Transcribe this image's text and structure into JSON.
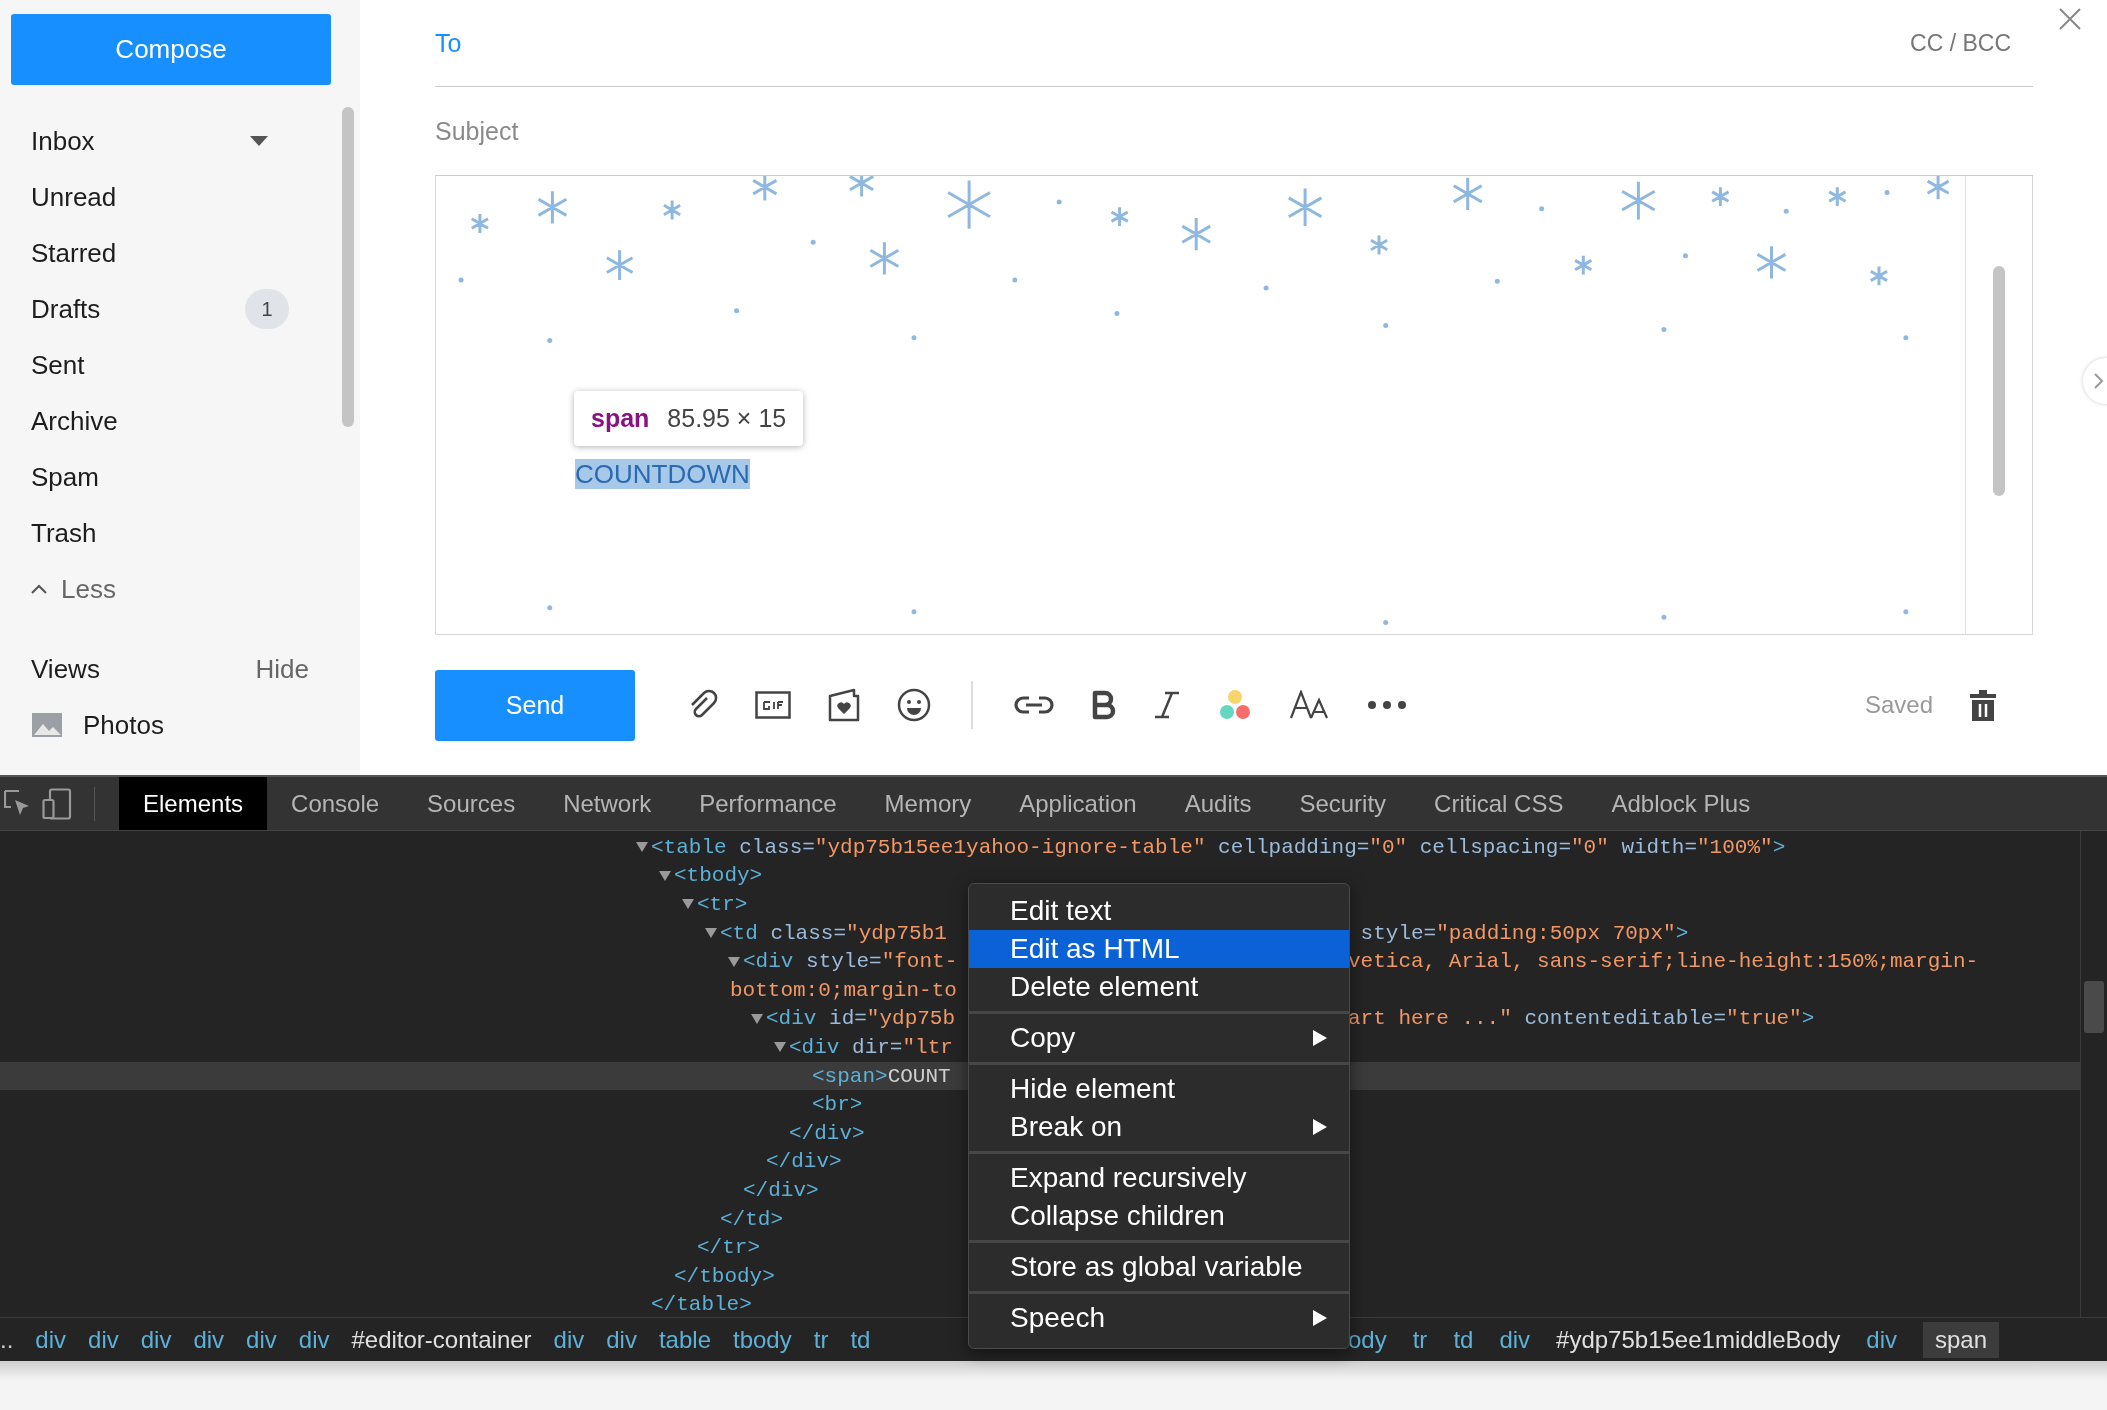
{
  "sidebar": {
    "compose": "Compose",
    "folders": [
      {
        "label": "Inbox",
        "kind": "dropdown"
      },
      {
        "label": "Unread",
        "kind": "plain"
      },
      {
        "label": "Starred",
        "kind": "plain"
      },
      {
        "label": "Drafts",
        "kind": "count",
        "count": "1"
      },
      {
        "label": "Sent",
        "kind": "plain"
      },
      {
        "label": "Archive",
        "kind": "plain"
      },
      {
        "label": "Spam",
        "kind": "plain"
      },
      {
        "label": "Trash",
        "kind": "plain"
      }
    ],
    "less": "Less",
    "views": "Views",
    "hide": "Hide",
    "photos": "Photos"
  },
  "compose": {
    "to_label": "To",
    "cc_bcc": "CC / BCC",
    "subject_placeholder": "Subject",
    "body": {
      "tooltip": {
        "tag": "span",
        "size": "85.95 × 15"
      },
      "selected_text": "COUNTDOWN"
    },
    "send": "Send",
    "status": "Saved"
  },
  "devtools": {
    "tabs": [
      {
        "label": "Elements",
        "selected": true
      },
      {
        "label": "Console",
        "selected": false
      },
      {
        "label": "Sources",
        "selected": false
      },
      {
        "label": "Network",
        "selected": false
      },
      {
        "label": "Performance",
        "selected": false
      },
      {
        "label": "Memory",
        "selected": false
      },
      {
        "label": "Application",
        "selected": false
      },
      {
        "label": "Audits",
        "selected": false
      },
      {
        "label": "Security",
        "selected": false
      },
      {
        "label": "Critical CSS",
        "selected": false
      },
      {
        "label": "Adblock Plus",
        "selected": false
      }
    ],
    "tree": [
      {
        "expanded": true,
        "selected": false,
        "open": [
          {
            "kind": "tag",
            "text": "<table"
          },
          {
            "kind": "attr",
            "text": " class="
          },
          {
            "kind": "value",
            "text": "\"ydp75b15ee1yahoo-ignore-table\""
          },
          {
            "kind": "attr",
            "text": " cellpadding="
          },
          {
            "kind": "value",
            "text": "\"0\""
          },
          {
            "kind": "attr",
            "text": " cellspacing="
          },
          {
            "kind": "value",
            "text": "\"0\""
          },
          {
            "kind": "attr",
            "text": " width="
          },
          {
            "kind": "value",
            "text": "\"100%\""
          },
          {
            "kind": "tag",
            "text": ">"
          }
        ],
        "close": "</table>",
        "children": [
          {
            "expanded": true,
            "selected": false,
            "open": [
              {
                "kind": "tag",
                "text": "<tbody>"
              }
            ],
            "close": "</tbody>",
            "children": [
              {
                "expanded": true,
                "selected": false,
                "open": [
                  {
                    "kind": "tag",
                    "text": "<tr>"
                  }
                ],
                "close": "</tr>",
                "children": [
                  {
                    "expanded": true,
                    "selected": false,
                    "open": [
                      {
                        "kind": "tag",
                        "text": "<td"
                      },
                      {
                        "kind": "attr",
                        "text": " class="
                      },
                      {
                        "kind": "value",
                        "text": "\"ydp75b1"
                      }
                    ],
                    "right": [
                      {
                        "kind": "attr",
                        "text": " style="
                      },
                      {
                        "kind": "value",
                        "text": "\"padding:50px 70px\""
                      },
                      {
                        "kind": "tag",
                        "text": ">"
                      }
                    ],
                    "close": "</td>",
                    "children": [
                      {
                        "expanded": true,
                        "selected": false,
                        "open": [
                          {
                            "kind": "tag",
                            "text": "<div"
                          },
                          {
                            "kind": "attr",
                            "text": " style="
                          },
                          {
                            "kind": "value",
                            "text": "\"font-"
                          }
                        ],
                        "right": [
                          {
                            "kind": "value",
                            "text": "vetica, Arial, sans-serif;line-height:150%;margin-"
                          }
                        ],
                        "wrap": [
                          {
                            "kind": "value",
                            "text": "bottom:0;margin-to"
                          }
                        ],
                        "close": "</div>",
                        "children": [
                          {
                            "expanded": true,
                            "selected": false,
                            "open": [
                              {
                                "kind": "tag",
                                "text": "<div"
                              },
                              {
                                "kind": "attr",
                                "text": " id="
                              },
                              {
                                "kind": "value",
                                "text": "\"ydp75b"
                              }
                            ],
                            "right": [
                              {
                                "kind": "value",
                                "text": "art here ...\""
                              },
                              {
                                "kind": "attr",
                                "text": " contenteditable="
                              },
                              {
                                "kind": "value",
                                "text": "\"true\""
                              },
                              {
                                "kind": "tag",
                                "text": ">"
                              }
                            ],
                            "close": "</div>",
                            "children": [
                              {
                                "expanded": true,
                                "selected": false,
                                "open": [
                                  {
                                    "kind": "tag",
                                    "text": "<div"
                                  },
                                  {
                                    "kind": "attr",
                                    "text": " dir="
                                  },
                                  {
                                    "kind": "value",
                                    "text": "\"ltr"
                                  }
                                ],
                                "close": "</div>",
                                "children": [
                                  {
                                    "selected": true,
                                    "open": [
                                      {
                                        "kind": "tag",
                                        "text": "<span>"
                                      },
                                      {
                                        "kind": "text",
                                        "text": "COUNT"
                                      }
                                    ]
                                  },
                                  {
                                    "selected": false,
                                    "open": [
                                      {
                                        "kind": "tag",
                                        "text": "<br>"
                                      }
                                    ]
                                  }
                                ]
                              }
                            ]
                          }
                        ]
                      }
                    ]
                  }
                ]
              }
            ]
          }
        ]
      }
    ],
    "breadcrumbs_left": [
      {
        "kind": "more",
        "text": "..",
        "selected": false
      },
      {
        "kind": "tag",
        "text": "div",
        "selected": false
      },
      {
        "kind": "tag",
        "text": "div",
        "selected": false
      },
      {
        "kind": "tag",
        "text": "div",
        "selected": false
      },
      {
        "kind": "tag",
        "text": "div",
        "selected": false
      },
      {
        "kind": "tag",
        "text": "div",
        "selected": false
      },
      {
        "kind": "tag",
        "text": "div",
        "selected": false
      },
      {
        "kind": "id",
        "text": "#editor-container",
        "selected": false
      },
      {
        "kind": "tag",
        "text": "div",
        "selected": false
      },
      {
        "kind": "tag",
        "text": "div",
        "selected": false
      },
      {
        "kind": "tag",
        "text": "table",
        "selected": false
      },
      {
        "kind": "tag",
        "text": "tbody",
        "selected": false
      },
      {
        "kind": "tag",
        "text": "tr",
        "selected": false
      },
      {
        "kind": "tag",
        "text": "td",
        "selected": false
      }
    ],
    "breadcrumbs_right": [
      {
        "kind": "tag",
        "text": "ody",
        "selected": false
      },
      {
        "kind": "tag",
        "text": "tr",
        "selected": false
      },
      {
        "kind": "tag",
        "text": "td",
        "selected": false
      },
      {
        "kind": "tag",
        "text": "div",
        "selected": false
      },
      {
        "kind": "id",
        "text": "#ydp75b15ee1middleBody",
        "selected": false
      },
      {
        "kind": "tag",
        "text": "div",
        "selected": false
      },
      {
        "kind": "tag",
        "text": "span",
        "selected": true
      }
    ]
  },
  "context_menu": [
    [
      {
        "label": "Edit text",
        "selected": false,
        "submenu": false
      },
      {
        "label": "Edit as HTML",
        "selected": true,
        "submenu": false
      },
      {
        "label": "Delete element",
        "selected": false,
        "submenu": false
      }
    ],
    [
      {
        "label": "Copy",
        "selected": false,
        "submenu": true
      }
    ],
    [
      {
        "label": "Hide element",
        "selected": false,
        "submenu": false
      },
      {
        "label": "Break on",
        "selected": false,
        "submenu": true
      }
    ],
    [
      {
        "label": "Expand recursively",
        "selected": false,
        "submenu": false
      },
      {
        "label": "Collapse children",
        "selected": false,
        "submenu": false
      }
    ],
    [
      {
        "label": "Store as global variable",
        "selected": false,
        "submenu": false
      }
    ],
    [
      {
        "label": "Speech",
        "selected": false,
        "submenu": true
      }
    ]
  ]
}
